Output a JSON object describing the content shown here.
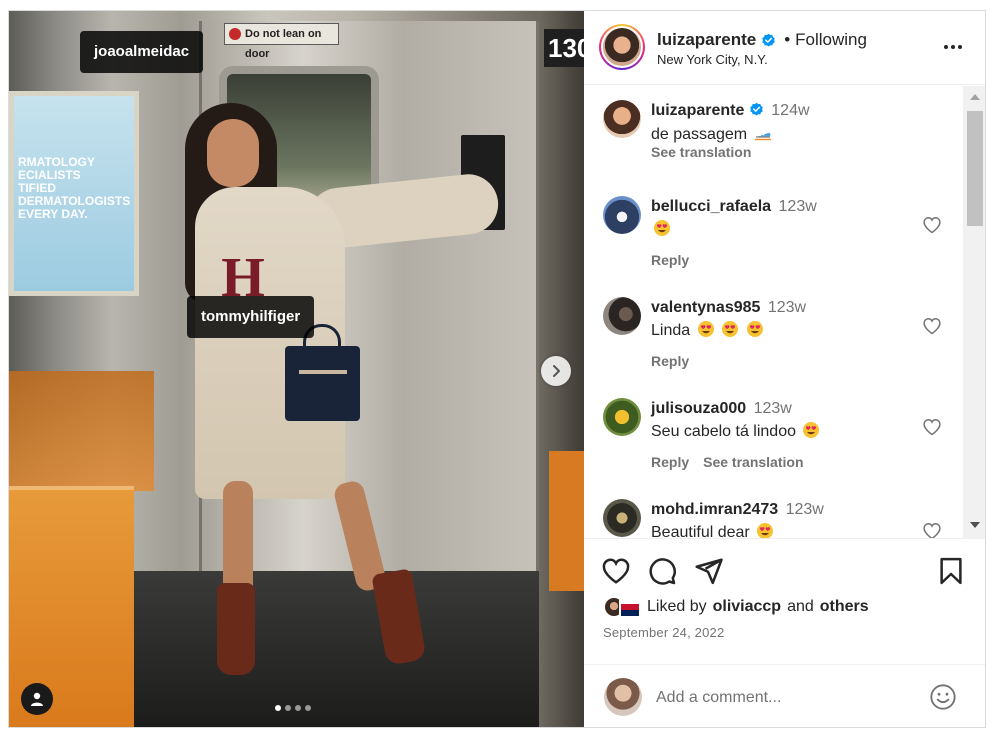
{
  "post": {
    "author": "luizaparente",
    "follow_state": "Following",
    "separator": "•",
    "location": "New York City, N.Y.",
    "caption_time": "124w",
    "caption": "de passagem",
    "caption_emoji": "train-emoji",
    "see_translation": "See translation",
    "date": "September 24, 2022"
  },
  "media": {
    "tags": [
      "joaoalmeidac",
      "tommyhilfiger"
    ],
    "door_sign": "Do not lean on door",
    "car_number": "130",
    "ad_text": "RMATOLOGY\nECIALISTS\nTIFIED DERMATOLOGISTS\nEVERY DAY.",
    "carousel_count": 4,
    "carousel_active": 0
  },
  "comments": [
    {
      "user": "bellucci_rafaela",
      "time": "123w",
      "text": "",
      "emojis": [
        "heart-eyes-emoji"
      ],
      "reply": "Reply",
      "translate": ""
    },
    {
      "user": "valentynas985",
      "time": "123w",
      "text": "Linda",
      "emojis": [
        "heart-eyes-emoji",
        "heart-eyes-emoji",
        "heart-eyes-emoji"
      ],
      "reply": "Reply",
      "translate": ""
    },
    {
      "user": "julisouza000",
      "time": "123w",
      "text": "Seu cabelo tá lindoo",
      "emojis": [
        "heart-eyes-emoji"
      ],
      "reply": "Reply",
      "translate": "See translation"
    },
    {
      "user": "mohd.imran2473",
      "time": "123w",
      "text": "Beautiful dear",
      "emojis": [
        "heart-eyes-emoji"
      ],
      "reply": "",
      "translate": ""
    }
  ],
  "likes": {
    "prefix": "Liked by",
    "user": "oliviaccp",
    "and": "and",
    "others": "others"
  },
  "composer": {
    "placeholder": "Add a comment..."
  },
  "colors": {
    "verified": "#0095f6",
    "text": "#262626",
    "secondary": "#737373",
    "border": "#dbdbdb"
  }
}
